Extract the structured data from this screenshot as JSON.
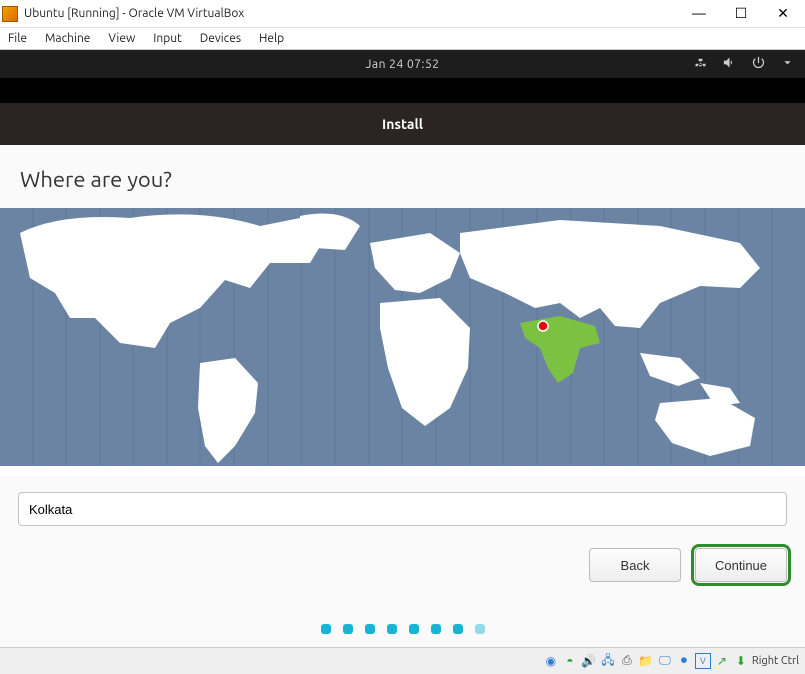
{
  "vbox": {
    "window_title": "Ubuntu [Running] - Oracle VM VirtualBox",
    "menus": {
      "file": "File",
      "machine": "Machine",
      "view": "View",
      "input": "Input",
      "devices": "Devices",
      "help": "Help"
    },
    "status_host_key": "Right Ctrl"
  },
  "ubuntu_topbar": {
    "datetime": "Jan 24  07:52"
  },
  "installer": {
    "title_bar": "Install",
    "heading": "Where are you?",
    "timezone_input_value": "Kolkata",
    "back_label": "Back",
    "continue_label": "Continue"
  }
}
